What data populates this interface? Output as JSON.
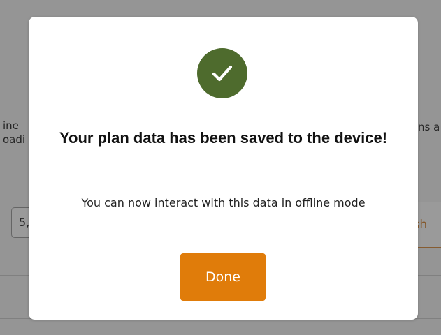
{
  "background": {
    "text_left_line1": "ine",
    "text_left_line2": "oadi",
    "text_right_line1": "ns a",
    "input_value": "5,",
    "button_label": "esh"
  },
  "modal": {
    "icon": "check-circle-icon",
    "icon_color": "#4e6b2d",
    "title": "Your plan data has been saved to the device!",
    "message": "You can now interact with this data in offline mode",
    "done_label": "Done",
    "done_color": "#e07c0a"
  }
}
